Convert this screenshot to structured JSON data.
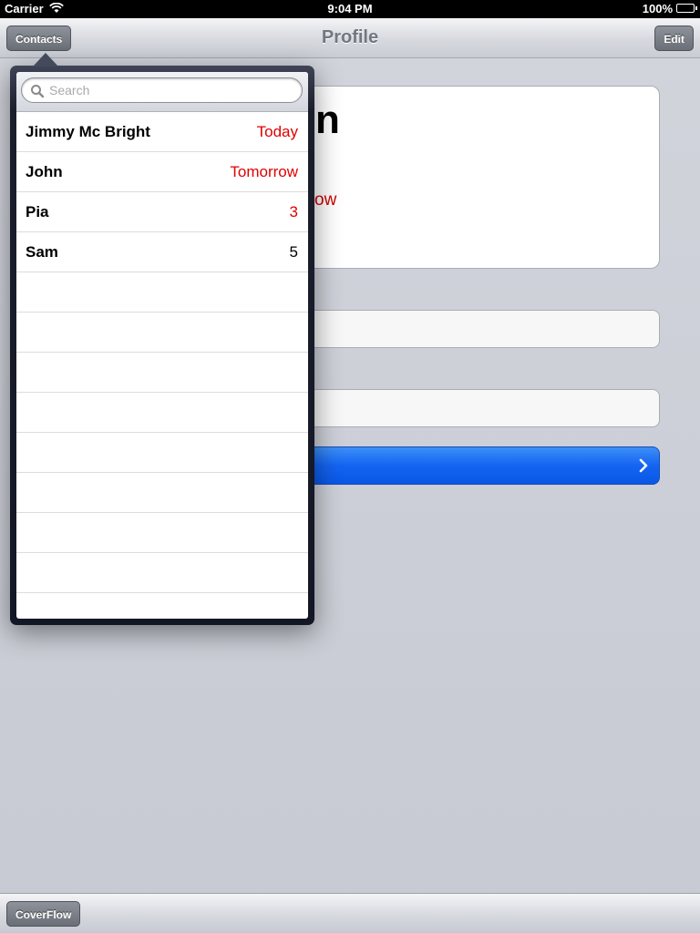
{
  "status_bar": {
    "carrier": "Carrier",
    "time": "9:04 PM",
    "battery": "100%"
  },
  "nav": {
    "title": "Profile",
    "left_button": "Contacts",
    "right_button": "Edit"
  },
  "profile": {
    "name_partial": "n",
    "due_partial": "ow"
  },
  "toolbar": {
    "coverflow_label": "CoverFlow"
  },
  "popover": {
    "search": {
      "placeholder": "Search",
      "value": ""
    },
    "contacts": [
      {
        "name": "Jimmy Mc Bright",
        "detail": "Today",
        "detail_color": "red"
      },
      {
        "name": "John",
        "detail": "Tomorrow",
        "detail_color": "red"
      },
      {
        "name": "Pia",
        "detail": "3",
        "detail_color": "red"
      },
      {
        "name": "Sam",
        "detail": "5",
        "detail_color": "black"
      }
    ]
  },
  "colors": {
    "accent_red": "#e00000",
    "blue_row": "#1464f1",
    "popover_frame": "#1b1e2c"
  }
}
